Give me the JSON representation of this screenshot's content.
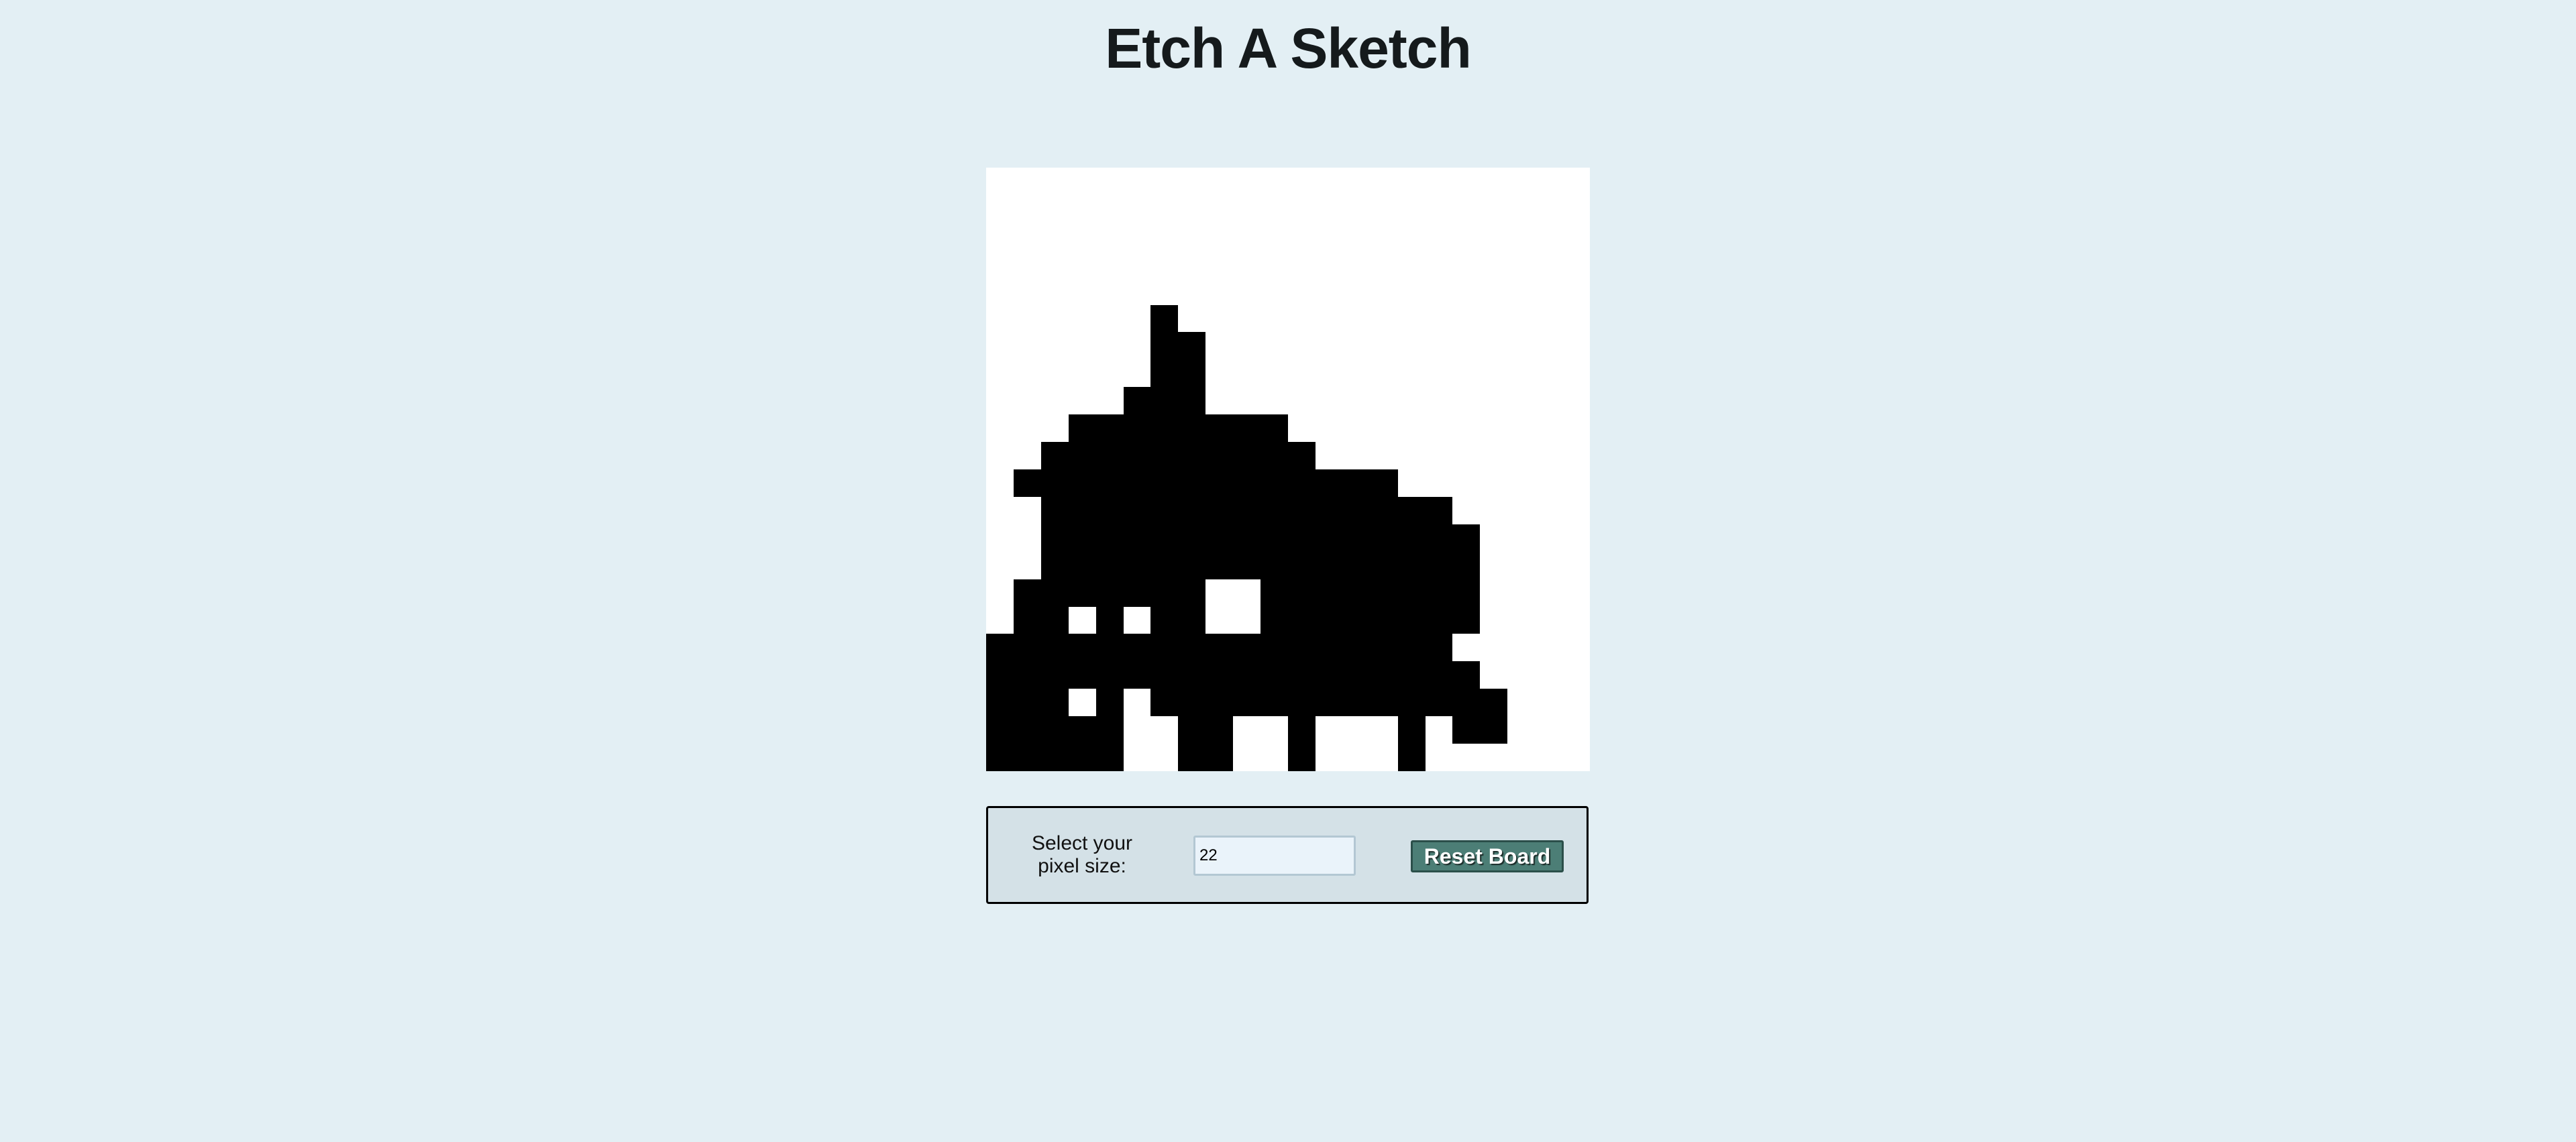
{
  "page": {
    "title": "Etch A Sketch",
    "background": "#e3eff4"
  },
  "board": {
    "grid_size": 22,
    "fill_color": "#000000",
    "empty_color": "#ffffff",
    "rows": [
      "......................",
      "......................",
      "......................",
      "......................",
      "......................",
      "......#...............",
      "......##..............",
      "......##..............",
      ".....###..............",
      "...########...........",
      "..##########..........",
      ".##############.......",
      "..###############.....",
      "..################....",
      "..################....",
      ".#######..########....",
      ".##.#.##..########....",
      "#################.....",
      "##################....",
      "###.#.#############...",
      "#####..##..#...#.##...",
      "#####..##..#...#......"
    ]
  },
  "controls": {
    "size_label": "Select your pixel size:",
    "size_value": "22",
    "reset_label": "Reset Board",
    "reset_color": "#4c7e76"
  }
}
